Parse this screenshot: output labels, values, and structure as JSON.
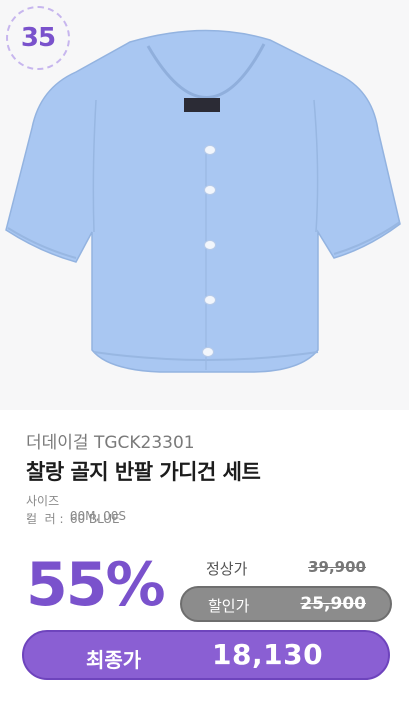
{
  "badge": {
    "rank": "35"
  },
  "product": {
    "brand_line": "더데이걸 TGCK23301",
    "title": "찰랑 골지 반팔 가디건 세트",
    "options": {
      "size_label": "사이즈 :",
      "size_value": "00M, 00S",
      "color_label": "컬  러 :",
      "color_value": "60 BLUE"
    },
    "garment_color": "#a9c7f2"
  },
  "pricing": {
    "discount_rate": "55%",
    "regular_label": "정상가",
    "regular_price": "39,900",
    "sale_label": "할인가",
    "sale_price": "25,900",
    "final_label": "최종가",
    "final_price": "18,130"
  },
  "colors": {
    "accent": "#7a52cc",
    "final_pill": "#8a5fd3",
    "sale_pill": "#8c8c8c"
  }
}
